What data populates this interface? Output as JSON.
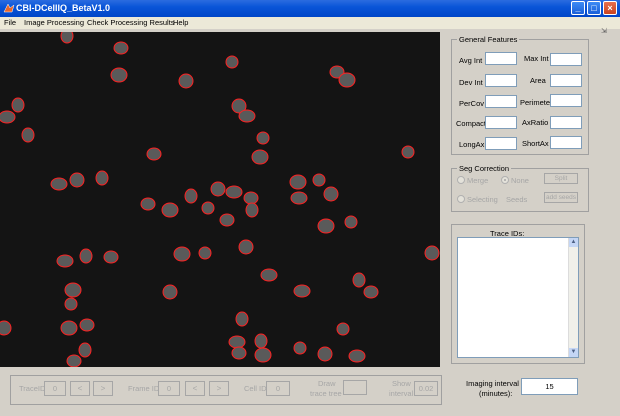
{
  "window": {
    "title": "CBI-DCellIQ_BetaV1.0",
    "minimize": "_",
    "maximize": "□",
    "close": "×"
  },
  "menu": [
    "File",
    "Image Processing",
    "Check Processing Results",
    "Help"
  ],
  "toolbar_arrow": "⇲",
  "general_features": {
    "title": "General Features",
    "labels": {
      "avg_int": "Avg Int",
      "max_int": "Max Int",
      "dev_int": "Dev Int",
      "area": "Area",
      "per_cov": "PerCov",
      "perimeter": "Perimeter",
      "compact": "Compact",
      "ax_ratio": "AxRatio",
      "long_ax": "LongAx",
      "short_ax": "ShortAx"
    }
  },
  "seg_correction": {
    "title": "Seg Correction",
    "merge": "Merge",
    "none": "None",
    "split": "Split",
    "selecting": "Selecting",
    "seeds": "Seeds",
    "add_seeds": "add seeds"
  },
  "trace_ids": {
    "title": "Trace IDs:"
  },
  "imaging_interval": {
    "label_1": "Imaging interval",
    "label_2": "(minutes):",
    "value": "15"
  },
  "bottom": {
    "trace_id_label": "TraceID",
    "trace_id_value": "0",
    "frame_id_label": "Frame ID",
    "frame_id_value": "0",
    "cell_id_label": "Cell ID",
    "cell_id_value": "0",
    "prev": "<",
    "next": ">",
    "draw_label_1": "Draw",
    "draw_label_2": "trace tree",
    "show_label_1": "Show",
    "show_label_2": "interval",
    "show_value": "0.02"
  },
  "colors": {
    "outline": "#ff2020",
    "canvas": "#141414",
    "titlebar": "#0a55d8"
  }
}
